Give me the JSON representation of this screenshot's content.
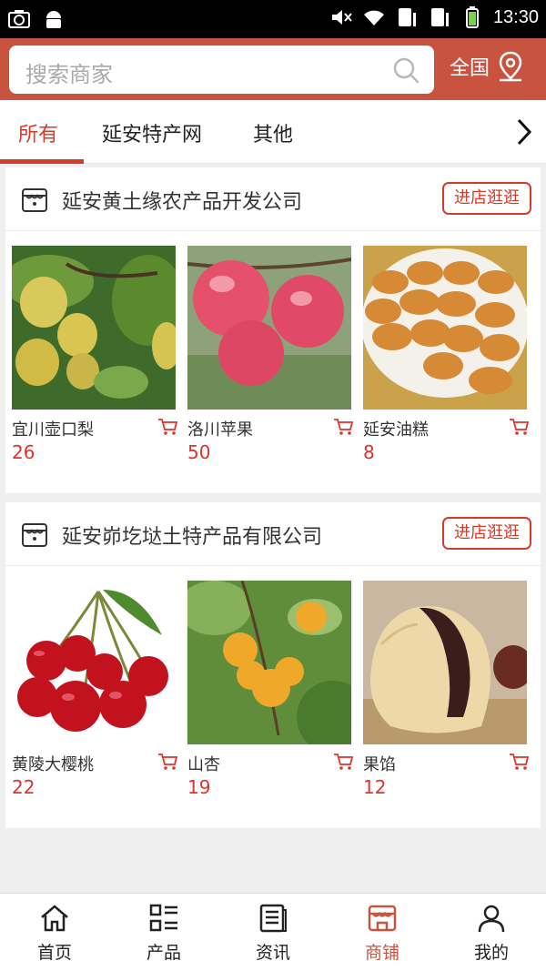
{
  "status_bar": {
    "time": "13:30"
  },
  "search": {
    "placeholder": "搜索商家"
  },
  "region": {
    "label": "全国"
  },
  "tabs": [
    {
      "label": "所有",
      "active": true
    },
    {
      "label": "延安特产网",
      "active": false
    },
    {
      "label": "其他",
      "active": false
    }
  ],
  "shops": [
    {
      "name": "延安黄土缘农产品开发公司",
      "visit_label": "进店逛逛",
      "products": [
        {
          "name": "宜川壶口梨",
          "price": "26"
        },
        {
          "name": "洛川苹果",
          "price": "50"
        },
        {
          "name": "延安油糕",
          "price": "8"
        }
      ]
    },
    {
      "name": "延安峁圪垯土特产品有限公司",
      "visit_label": "进店逛逛",
      "products": [
        {
          "name": "黄陵大樱桃",
          "price": "22"
        },
        {
          "name": "山杏",
          "price": "19"
        },
        {
          "name": "果馅",
          "price": "12"
        }
      ]
    }
  ],
  "bottom_nav": [
    {
      "label": "首页",
      "icon": "home-icon",
      "active": false
    },
    {
      "label": "产品",
      "icon": "grid-list-icon",
      "active": false
    },
    {
      "label": "资讯",
      "icon": "news-icon",
      "active": false
    },
    {
      "label": "商铺",
      "icon": "store-icon",
      "active": true
    },
    {
      "label": "我的",
      "icon": "user-icon",
      "active": false
    }
  ],
  "colors": {
    "header": "#c8543f",
    "accent": "#d63a2a",
    "price": "#e0332a"
  }
}
